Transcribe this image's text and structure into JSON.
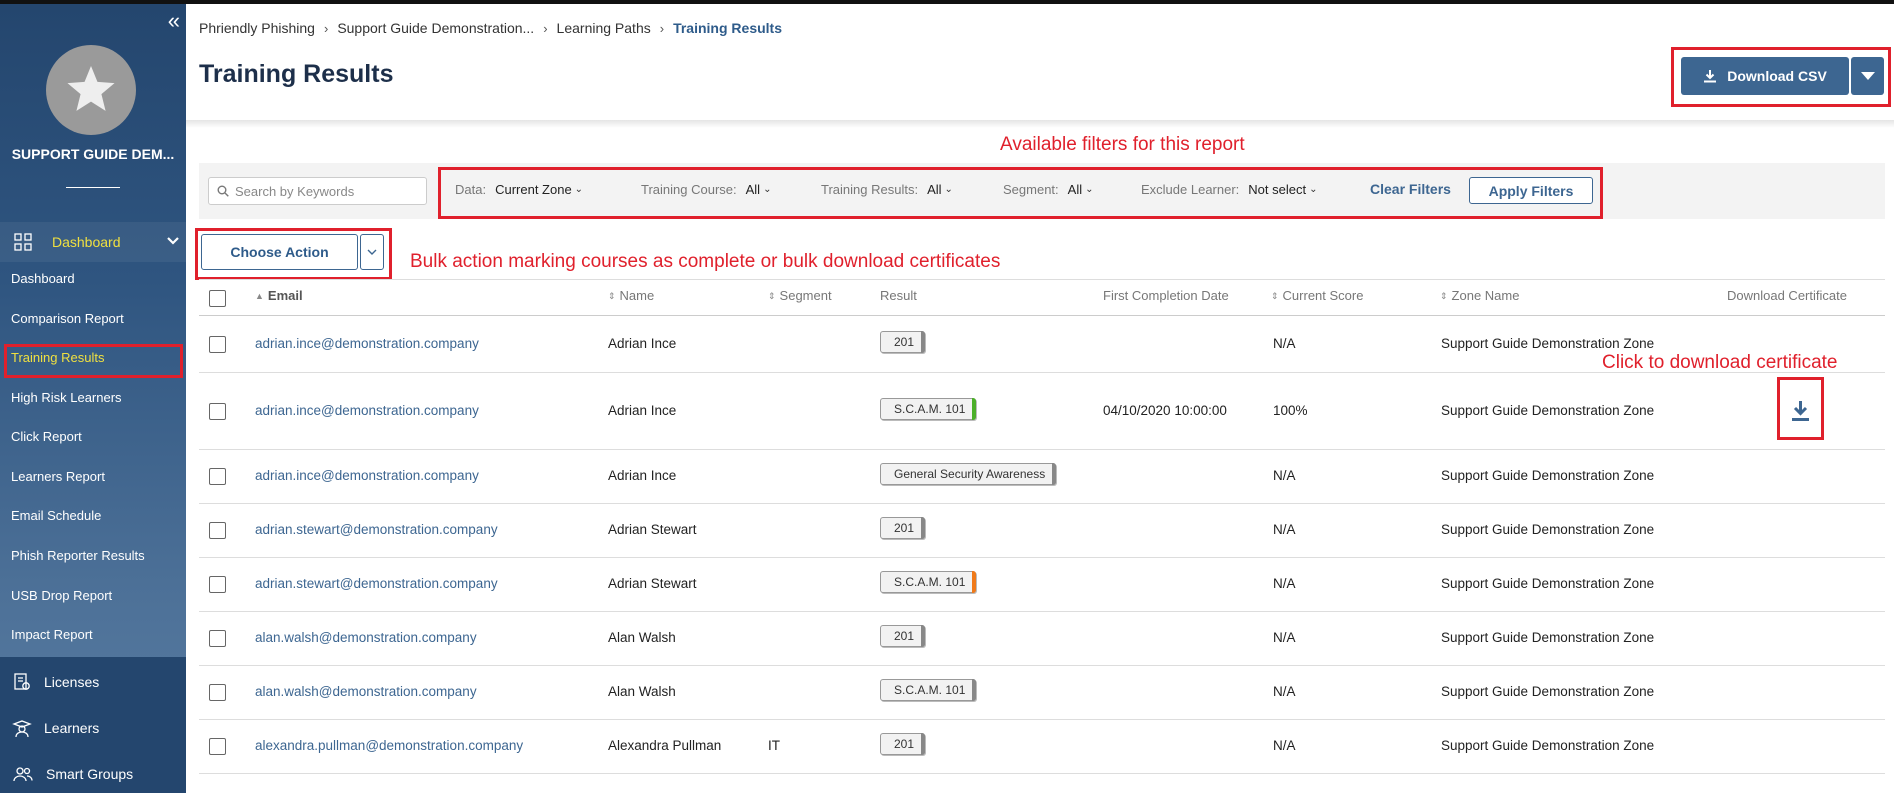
{
  "sidebar": {
    "org_name": "SUPPORT GUIDE DEM...",
    "dashboard_label": "Dashboard",
    "sub_items": [
      {
        "label": "Dashboard",
        "active": false
      },
      {
        "label": "Comparison Report",
        "active": false
      },
      {
        "label": "Training Results",
        "active": true
      },
      {
        "label": "High Risk Learners",
        "active": false
      },
      {
        "label": "Click Report",
        "active": false
      },
      {
        "label": "Learners Report",
        "active": false
      },
      {
        "label": "Email Schedule",
        "active": false
      },
      {
        "label": "Phish Reporter Results",
        "active": false
      },
      {
        "label": "USB Drop Report",
        "active": false
      },
      {
        "label": "Impact Report",
        "active": false
      }
    ],
    "lower_items": [
      {
        "label": "Licenses",
        "icon": "license-icon"
      },
      {
        "label": "Learners",
        "icon": "learner-icon"
      },
      {
        "label": "Smart Groups",
        "icon": "group-icon"
      }
    ]
  },
  "breadcrumb": {
    "items": [
      "Phriendly Phishing",
      "Support Guide Demonstration...",
      "Learning Paths"
    ],
    "current": "Training Results"
  },
  "page": {
    "title": "Training Results",
    "download_csv_label": "Download CSV"
  },
  "annotations": {
    "filters_note": "Available filters for this report",
    "bulk_note": "Bulk action marking courses as complete or bulk download certificates",
    "cert_note": "Click to download certificate"
  },
  "filters": {
    "search_placeholder": "Search by Keywords",
    "data_label": "Data:",
    "data_value": "Current Zone",
    "course_label": "Training Course:",
    "course_value": "All",
    "results_label": "Training Results:",
    "results_value": "All",
    "segment_label": "Segment:",
    "segment_value": "All",
    "exclude_label": "Exclude Learner:",
    "exclude_value": "Not select",
    "clear_label": "Clear Filters",
    "apply_label": "Apply Filters"
  },
  "actions": {
    "choose_action_label": "Choose Action"
  },
  "table": {
    "headers": {
      "email": "Email",
      "name": "Name",
      "segment": "Segment",
      "result": "Result",
      "first_completion": "First Completion Date",
      "current_score": "Current Score",
      "zone_name": "Zone Name",
      "download_certificate": "Download Certificate"
    },
    "rows": [
      {
        "email": "adrian.ince@demonstration.company",
        "name": "Adrian Ince",
        "segment": "",
        "result": "201",
        "result_color": "#888888",
        "first_completion": "",
        "score": "N/A",
        "zone": "Support Guide Demonstration Zone",
        "certificate": false
      },
      {
        "email": "adrian.ince@demonstration.company",
        "name": "Adrian Ince",
        "segment": "",
        "result": "S.C.A.M. 101",
        "result_color": "#4caf2a",
        "first_completion": "04/10/2020 10:00:00",
        "score": "100%",
        "zone": "Support Guide Demonstration Zone",
        "certificate": true
      },
      {
        "email": "adrian.ince@demonstration.company",
        "name": "Adrian Ince",
        "segment": "",
        "result": "General Security Awareness",
        "result_color": "#888888",
        "first_completion": "",
        "score": "N/A",
        "zone": "Support Guide Demonstration Zone",
        "certificate": false
      },
      {
        "email": "adrian.stewart@demonstration.company",
        "name": "Adrian Stewart",
        "segment": "",
        "result": "201",
        "result_color": "#888888",
        "first_completion": "",
        "score": "N/A",
        "zone": "Support Guide Demonstration Zone",
        "certificate": false
      },
      {
        "email": "adrian.stewart@demonstration.company",
        "name": "Adrian Stewart",
        "segment": "",
        "result": "S.C.A.M. 101",
        "result_color": "#f07a1a",
        "first_completion": "",
        "score": "N/A",
        "zone": "Support Guide Demonstration Zone",
        "certificate": false
      },
      {
        "email": "alan.walsh@demonstration.company",
        "name": "Alan Walsh",
        "segment": "",
        "result": "201",
        "result_color": "#888888",
        "first_completion": "",
        "score": "N/A",
        "zone": "Support Guide Demonstration Zone",
        "certificate": false
      },
      {
        "email": "alan.walsh@demonstration.company",
        "name": "Alan Walsh",
        "segment": "",
        "result": "S.C.A.M. 101",
        "result_color": "#888888",
        "first_completion": "",
        "score": "N/A",
        "zone": "Support Guide Demonstration Zone",
        "certificate": false
      },
      {
        "email": "alexandra.pullman@demonstration.company",
        "name": "Alexandra Pullman",
        "segment": "IT",
        "result": "201",
        "result_color": "#888888",
        "first_completion": "",
        "score": "N/A",
        "zone": "Support Guide Demonstration Zone",
        "certificate": false
      }
    ]
  },
  "colors": {
    "accent": "#3d6691",
    "annotation_red": "#e0202c",
    "sidebar_active": "#f0e040"
  }
}
